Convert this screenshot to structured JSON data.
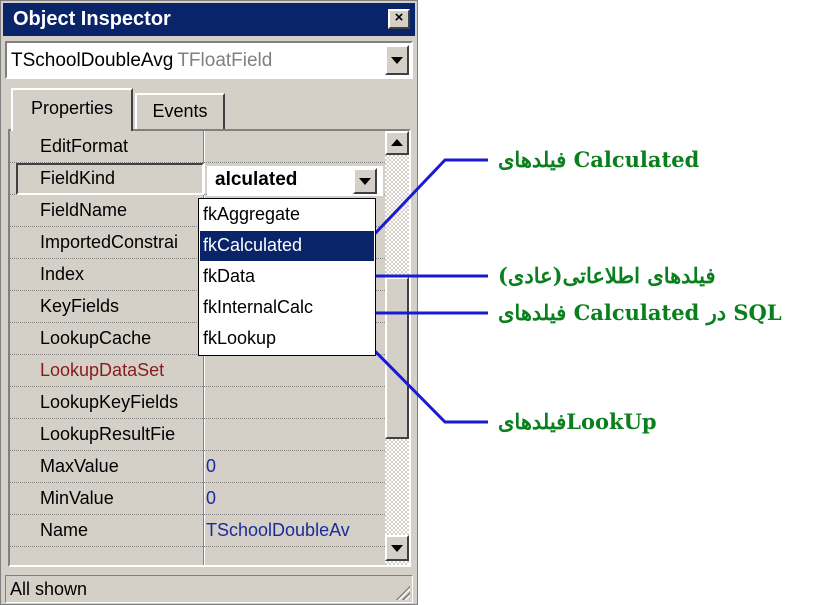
{
  "window": {
    "title": "Object Inspector",
    "close_glyph": "×"
  },
  "object_combo": {
    "name": "TSchoolDoubleAvg",
    "type": "TFloatField"
  },
  "tabs": [
    {
      "label": "Properties"
    },
    {
      "label": "Events"
    }
  ],
  "properties": [
    {
      "name": "EditFormat",
      "value": ""
    },
    {
      "name": "FieldKind",
      "value": "alculated"
    },
    {
      "name": "FieldName",
      "value": ""
    },
    {
      "name": "ImportedConstrai",
      "value": ""
    },
    {
      "name": "Index",
      "value": ""
    },
    {
      "name": "KeyFields",
      "value": ""
    },
    {
      "name": "LookupCache",
      "value": ""
    },
    {
      "name": "LookupDataSet",
      "value": ""
    },
    {
      "name": "LookupKeyFields",
      "value": ""
    },
    {
      "name": "LookupResultFie",
      "value": ""
    },
    {
      "name": "MaxValue",
      "value": "0"
    },
    {
      "name": "MinValue",
      "value": "0"
    },
    {
      "name": "Name",
      "value": "TSchoolDoubleAv"
    }
  ],
  "fieldkind_options": [
    "fkAggregate",
    "fkCalculated",
    "fkData",
    "fkInternalCalc",
    "fkLookup"
  ],
  "selected_option": "fkCalculated",
  "status": {
    "text": "All shown"
  },
  "annotations": [
    {
      "text": "فیلدهای Calculated"
    },
    {
      "text": "فیلدهای اطلاعاتی(عادی)"
    },
    {
      "text": "فیلدهای Calculated در SQL"
    },
    {
      "text": "فیلدهایLookUp"
    }
  ],
  "colors": {
    "title_bar": "#0a246a",
    "annotation_text": "#0a7f1e",
    "callout_line": "#1a1ad0",
    "red_property": "#8b1a1a"
  }
}
